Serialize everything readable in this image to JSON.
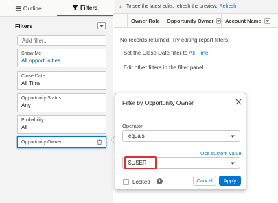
{
  "tabs": [
    {
      "label": "Outline",
      "icon": "list-icon",
      "active": false
    },
    {
      "label": "Filters",
      "icon": "funnel-icon",
      "active": true
    }
  ],
  "filters_panel": {
    "title": "Filters",
    "add_placeholder": "Add filter...",
    "items": [
      {
        "label": "Show Me",
        "value": "All opportunities"
      },
      {
        "label": "Close Date",
        "value": "All Time"
      },
      {
        "label": "Opportunity Status",
        "value": "Any"
      },
      {
        "label": "Probability",
        "value": "All"
      },
      {
        "label": "Opportunity Owner",
        "value": ""
      }
    ]
  },
  "banner": {
    "text": "To see the latest edits, refresh the preview.",
    "link": "Refresh"
  },
  "columns": [
    "Owner Role",
    "Opportunity Owner",
    "Account Name"
  ],
  "messages": {
    "no_records": "No records returned. Try editing report filters:",
    "hint1_prefix": "· Set the Close Date filter to ",
    "hint1_link": "All Time",
    "hint1_suffix": ".",
    "hint2": "· Edit other filters in the filter panel."
  },
  "modal": {
    "title": "Filter by Opportunity Owner",
    "operator_label": "Operator",
    "operator_value": "equals",
    "custom_link": "Use custom value",
    "value": "$USER",
    "locked_label": "Locked",
    "info": "i",
    "cancel": "Cancel",
    "apply": "Apply"
  },
  "colors": {
    "accent": "#0176d3",
    "highlight": "#e0302e",
    "warning": "#fe9339"
  }
}
